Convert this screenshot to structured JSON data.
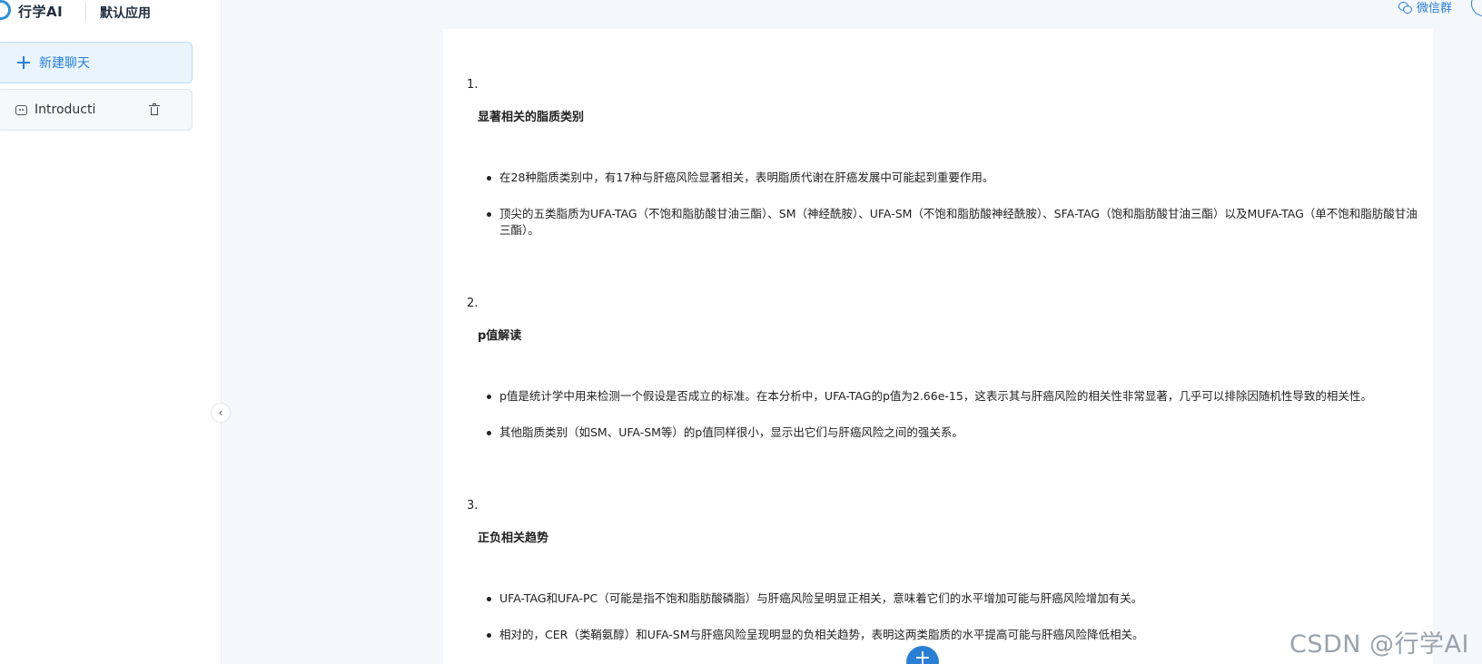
{
  "brand": {
    "name": "行学AI",
    "app_name": "默认应用"
  },
  "sidebar": {
    "new_chat_label": "新建聊天",
    "chats": [
      {
        "title": "Introducti"
      }
    ],
    "collapse_icon": "chevron-left-icon"
  },
  "header": {
    "wechat_label": "微信群"
  },
  "content": {
    "sections": [
      {
        "number": "1.",
        "title": "显著相关的脂质类别",
        "bullets": [
          "在28种脂质类别中，有17种与肝癌风险显著相关，表明脂质代谢在肝癌发展中可能起到重要作用。",
          "顶尖的五类脂质为UFA-TAG（不饱和脂肪酸甘油三酯）、SM（神经酰胺）、UFA-SM（不饱和脂肪酸神经酰胺）、SFA-TAG（饱和脂肪酸甘油三酯）以及MUFA-TAG（单不饱和脂肪酸甘油三酯）。"
        ]
      },
      {
        "number": "2.",
        "title": "p值解读",
        "bullets": [
          "p值是统计学中用来检测一个假设是否成立的标准。在本分析中，UFA-TAG的p值为2.66e-15，这表示其与肝癌风险的相关性非常显著，几乎可以排除因随机性导致的相关性。",
          "其他脂质类别（如SM、UFA-SM等）的p值同样很小，显示出它们与肝癌风险之间的强关系。"
        ]
      },
      {
        "number": "3.",
        "title": "正负相关趋势",
        "bullets": [
          "UFA-TAG和UFA-PC（可能是指不饱和脂肪酸磷脂）与肝癌风险呈明显正相关，意味着它们的水平增加可能与肝癌风险增加有关。",
          "相对的，CER（类鞘氨醇）和UFA-SM与肝癌风险呈现明显的负相关趋势，表明这两类脂质的水平提高可能与肝癌风险降低相关。"
        ]
      }
    ]
  },
  "watermark": "CSDN @行学AI",
  "colors": {
    "accent": "#2a7fd4",
    "sidebar_bg": "#ffffff",
    "page_bg": "#f4f7fb"
  }
}
